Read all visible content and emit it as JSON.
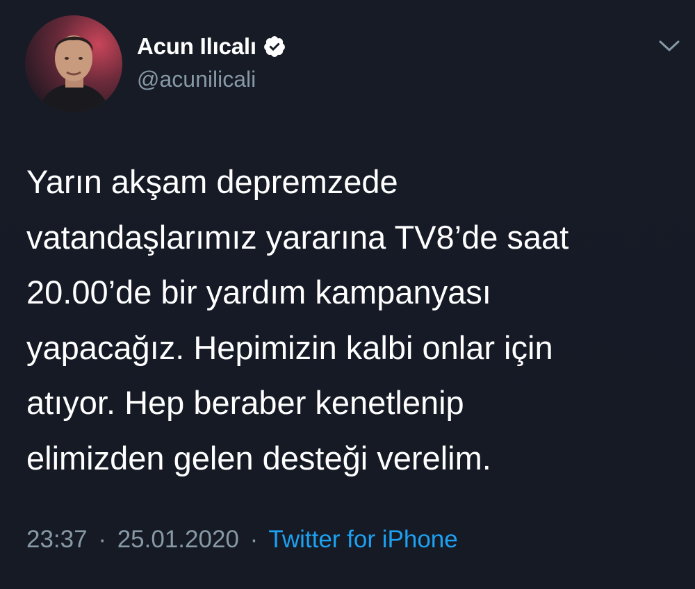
{
  "author": {
    "display_name": "Acun Ilıcalı",
    "handle": "@acunilicali",
    "verified": true,
    "avatar_icon": "profile-photo"
  },
  "menu": {
    "icon": "chevron-down-icon"
  },
  "tweet": {
    "text": "Yarın akşam depremzede\nvatandaşlarımız yararına TV8’de saat\n20.00’de bir yardım kampanyası\nyapacağız. Hepimizin kalbi onlar için\natıyor. Hep beraber kenetlenip\nelimizden gelen desteği verelim."
  },
  "meta": {
    "time": "23:37",
    "date": "25.01.2020",
    "separator": "·",
    "source": "Twitter for iPhone"
  },
  "colors": {
    "background": "#161b26",
    "text_primary": "#ffffff",
    "text_secondary": "#8899a6",
    "link": "#1da1f2"
  }
}
